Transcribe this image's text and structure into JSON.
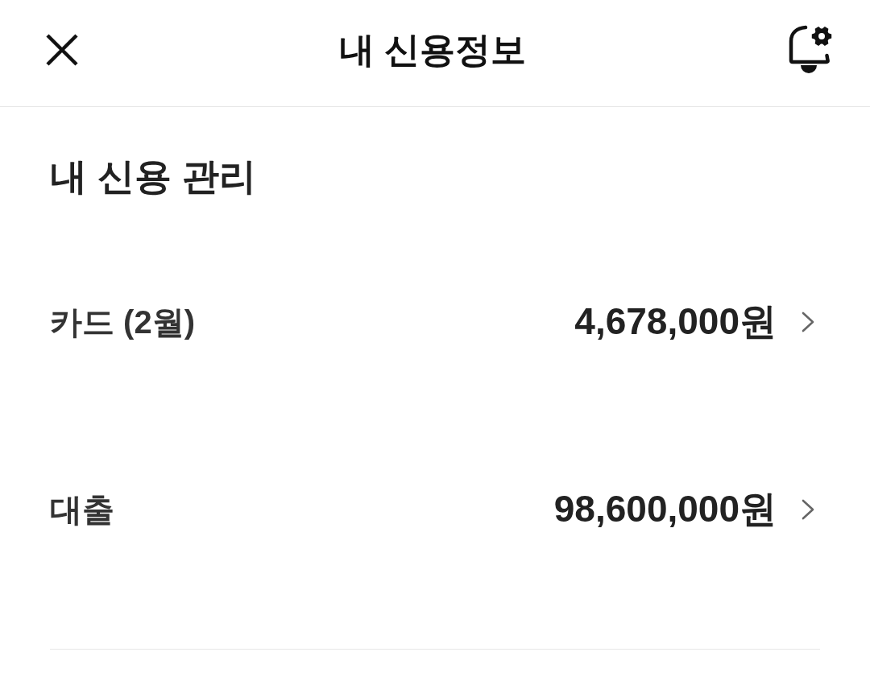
{
  "header": {
    "title": "내 신용정보"
  },
  "section": {
    "title": "내 신용 관리",
    "items": [
      {
        "label": "카드 (2월)",
        "amount": "4,678,000원"
      },
      {
        "label": "대출",
        "amount": "98,600,000원"
      }
    ]
  }
}
